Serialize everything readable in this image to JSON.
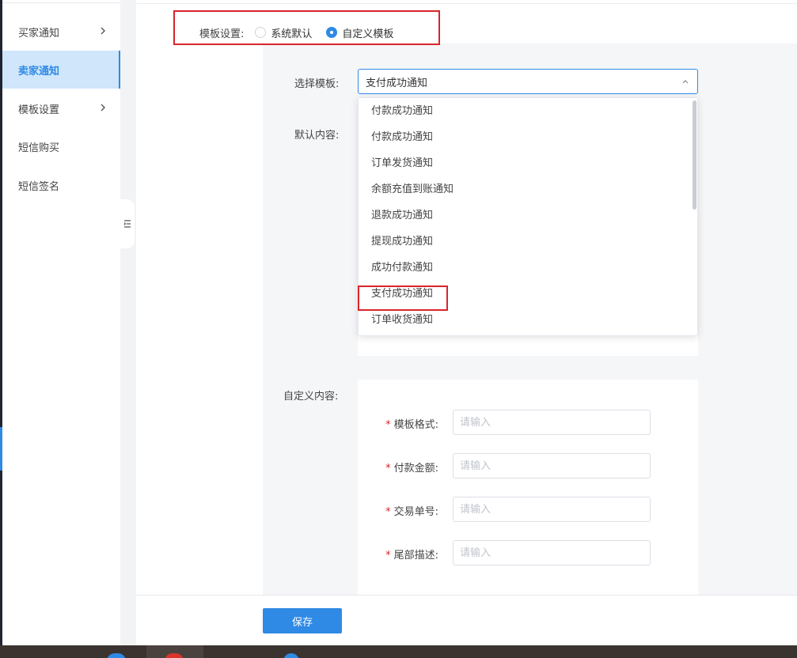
{
  "sidebar": {
    "items": [
      {
        "label": "买家通知",
        "has_arrow": true
      },
      {
        "label": "卖家通知",
        "active": true
      },
      {
        "label": "模板设置",
        "has_arrow": true
      },
      {
        "label": "短信购买"
      },
      {
        "label": "短信签名"
      }
    ]
  },
  "template_setting": {
    "label": "模板设置:",
    "options": [
      "系统默认",
      "自定义模板"
    ],
    "selected": "自定义模板"
  },
  "select_template": {
    "label": "选择模板:",
    "value": "支付成功通知",
    "options": [
      "付款成功通知",
      "付款成功通知",
      "订单发货通知",
      "余额充值到账通知",
      "退款成功通知",
      "提现成功通知",
      "成功付款通知",
      "支付成功通知",
      "订单收货通知"
    ],
    "highlighted": "支付成功通知"
  },
  "default_content": {
    "label": "默认内容:"
  },
  "custom_content": {
    "label": "自定义内容:",
    "fields": [
      {
        "label": "模板格式:",
        "placeholder": "请输入"
      },
      {
        "label": "付款金额:",
        "placeholder": "请输入"
      },
      {
        "label": "交易单号:",
        "placeholder": "请输入"
      },
      {
        "label": "尾部描述:",
        "placeholder": "请输入"
      }
    ]
  },
  "footer": {
    "save_label": "保存"
  },
  "colors": {
    "accent": "#2f8ae5",
    "highlight": "#d9242a"
  }
}
